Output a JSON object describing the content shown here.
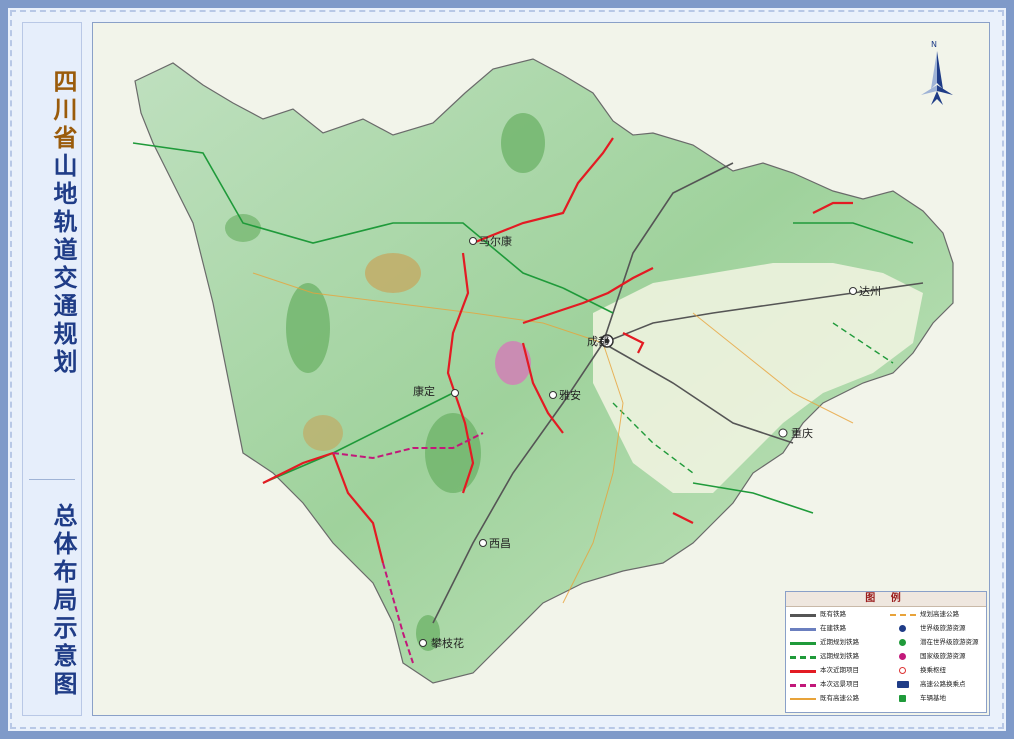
{
  "title": {
    "main_chars": [
      "四",
      "川",
      "省",
      "山",
      "地",
      "轨",
      "道",
      "交",
      "通",
      "规",
      "划"
    ],
    "sub_chars": [
      "总",
      "体",
      "布",
      "局",
      "示",
      "意",
      "图"
    ]
  },
  "compass": {
    "label": "N"
  },
  "map": {
    "cities": {
      "chengdu": "成都",
      "chongqing": "重庆",
      "dazhou": "达州",
      "xichang": "西昌",
      "kangding": "康定",
      "panzhihua": "攀枝花",
      "maerkang": "马尔康",
      "yaan": "雅安"
    }
  },
  "legend": {
    "title": "图 例",
    "left": [
      "既有铁路",
      "在建铁路",
      "近期规划铁路",
      "远期规划铁路",
      "本次近期项目",
      "本次远景项目",
      "既有高速公路"
    ],
    "right": [
      "规划高速公路",
      "世界级旅游资源",
      "潜在世界级旅游资源",
      "国家级旅游资源",
      "换乘枢纽",
      "高速公路换乘点",
      "车辆基地"
    ],
    "colors": {
      "existing_rail": "#555555",
      "construction_rail": "#6b7fbf",
      "near_plan_rail": "#1f9a3a",
      "far_plan_rail": "#1f9a3a",
      "near_project": "#e31b23",
      "far_project": "#c2187a",
      "existing_highway": "#e8a33a",
      "planned_highway": "#e8a33a",
      "world_resource": "#1f3c87",
      "potential_world_resource": "#1f9a3a",
      "national_resource": "#c2187a",
      "transfer_hub": "#d33",
      "highway_transfer": "#1f3c87",
      "depot": "#1f9a3a"
    }
  }
}
